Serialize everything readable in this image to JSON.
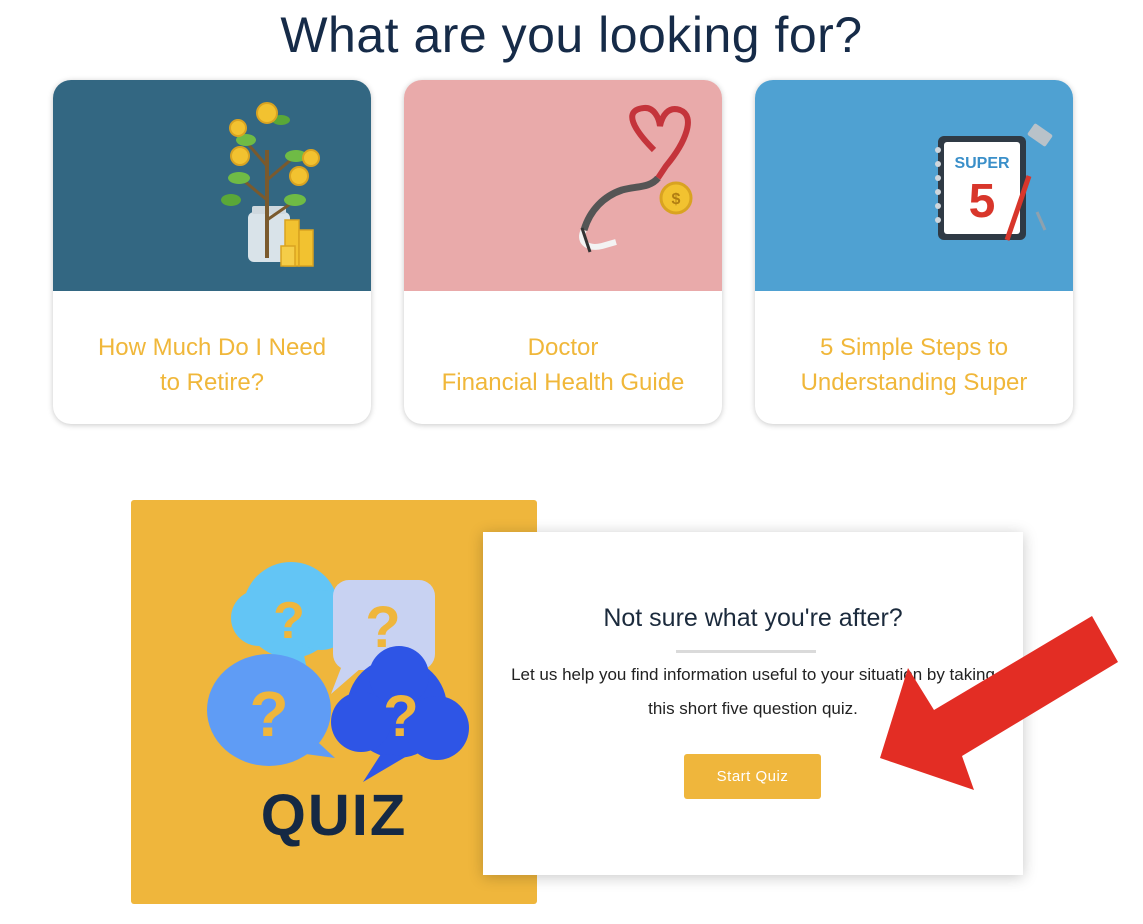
{
  "heading": "What are you looking for?",
  "cards": [
    {
      "label": "How Much Do I Need\nto Retire?",
      "icon": "money-tree-jar-icon",
      "bg": "#336782"
    },
    {
      "label": "Doctor\nFinancial Health Guide",
      "icon": "stethoscope-heart-icon",
      "bg": "#e9aaaa"
    },
    {
      "label": "5 Simple Steps to\nUnderstanding Super",
      "icon": "super-calendar-icon",
      "bg": "#4fa1d2",
      "calendar_word": "SUPER",
      "calendar_number": "5"
    }
  ],
  "quiz": {
    "tile_word": "QUIZ",
    "bubble_mark": "?",
    "title": "Not sure what you're after?",
    "body": "Let us help you find information useful to your situation by taking this short five question quiz.",
    "button_label": "Start Quiz"
  },
  "colors": {
    "accent": "#efb63c",
    "heading": "#162b48",
    "arrow": "#e32d24"
  }
}
